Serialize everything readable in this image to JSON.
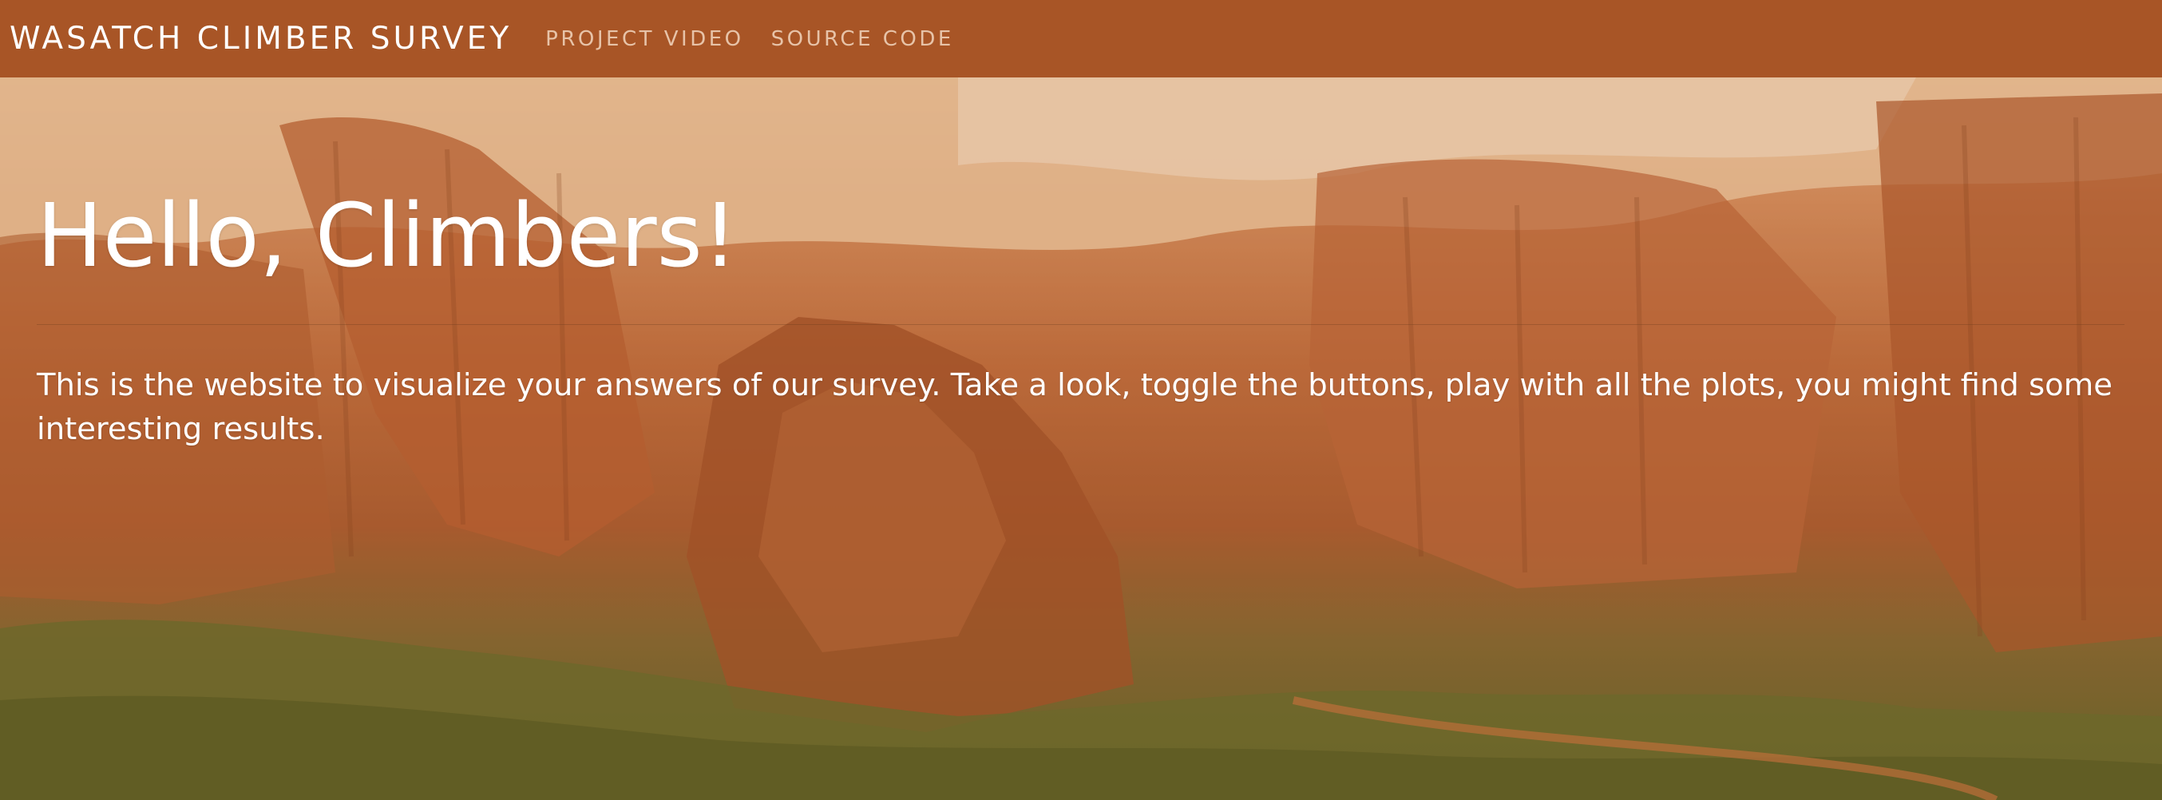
{
  "navbar": {
    "brand": "WASATCH CLIMBER SURVEY",
    "links": [
      {
        "label": "PROJECT VIDEO"
      },
      {
        "label": "SOURCE CODE"
      }
    ]
  },
  "hero": {
    "title": "Hello, Climbers!",
    "text": "This is the website to visualize your answers of our survey. Take a look, toggle the buttons, play with all the plots, you might find some interesting results.",
    "background_image": "red rock canyon landscape"
  },
  "colors": {
    "navbar": "#a85526",
    "brand_text": "#ffffff",
    "nav_link_text": "#e7c3a8",
    "hero_text": "#ffffff"
  }
}
